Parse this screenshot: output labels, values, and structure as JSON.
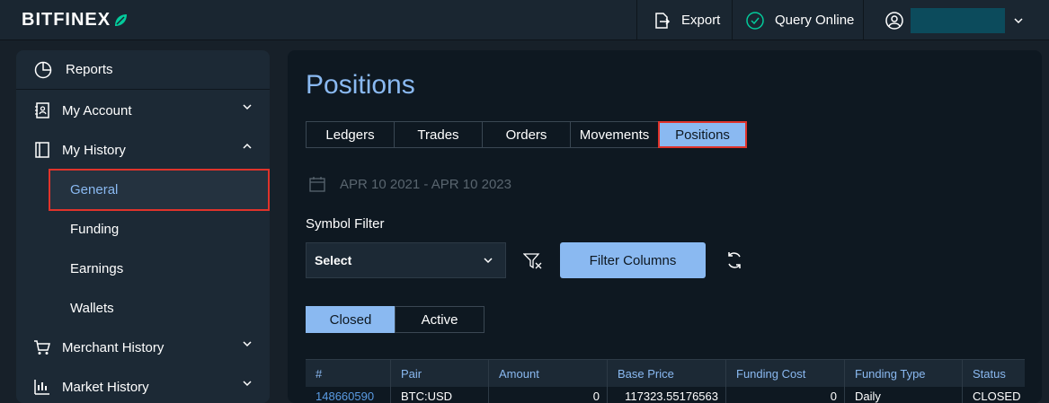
{
  "header": {
    "logo_text": "BITFINEX",
    "export_label": "Export",
    "query_label": "Query Online"
  },
  "sidebar": {
    "reports_label": "Reports",
    "items": [
      {
        "label": "My Account",
        "icon": "account-icon"
      },
      {
        "label": "My History",
        "icon": "history-icon"
      },
      {
        "label": "Merchant History",
        "icon": "cart-icon"
      },
      {
        "label": "Market History",
        "icon": "chart-icon"
      }
    ],
    "sub_items": [
      {
        "label": "General",
        "active": true
      },
      {
        "label": "Funding"
      },
      {
        "label": "Earnings"
      },
      {
        "label": "Wallets"
      }
    ]
  },
  "main": {
    "title": "Positions",
    "tabs": [
      "Ledgers",
      "Trades",
      "Orders",
      "Movements",
      "Positions"
    ],
    "active_tab": "Positions",
    "date_range": "APR 10 2021 - APR 10 2023",
    "symbol_filter_label": "Symbol Filter",
    "select_value": "Select",
    "filter_columns_label": "Filter Columns",
    "toggle": [
      "Closed",
      "Active"
    ],
    "toggle_active": "Closed"
  },
  "table": {
    "headers": [
      "#",
      "Pair",
      "Amount",
      "Base Price",
      "Funding Cost",
      "Funding Type",
      "Status"
    ],
    "rows": [
      [
        "148660590",
        "BTC:USD",
        "0",
        "117323.55176563",
        "0",
        "Daily",
        "CLOSED"
      ]
    ]
  },
  "colors": {
    "accent": "#8ab9f1",
    "highlight": "#e0332b",
    "logo_leaf": "#03ca9b"
  }
}
